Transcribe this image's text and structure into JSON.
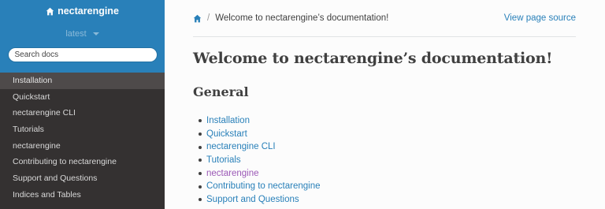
{
  "sidebar": {
    "project_name": "nectarengine",
    "version": "latest",
    "search_placeholder": "Search docs",
    "items": [
      {
        "label": "Installation"
      },
      {
        "label": "Quickstart"
      },
      {
        "label": "nectarengine CLI"
      },
      {
        "label": "Tutorials"
      },
      {
        "label": "nectarengine"
      },
      {
        "label": "Contributing to nectarengine"
      },
      {
        "label": "Support and Questions"
      },
      {
        "label": "Indices and Tables"
      }
    ]
  },
  "breadcrumb": {
    "current": "Welcome to nectarengine’s documentation!",
    "view_source": "View page source"
  },
  "main": {
    "title": "Welcome to nectarengine’s documentation!",
    "section_heading": "General",
    "toc": [
      {
        "label": "Installation"
      },
      {
        "label": "Quickstart"
      },
      {
        "label": "nectarengine CLI"
      },
      {
        "label": "Tutorials"
      },
      {
        "label": "nectarengine"
      },
      {
        "label": "Contributing to nectarengine"
      },
      {
        "label": "Support and Questions"
      }
    ]
  },
  "colors": {
    "accent": "#2980b9",
    "visited_link": "#9b59b6",
    "sidebar_bg": "#343131",
    "sidebar_current_bg": "#4e4a4a"
  },
  "icons": {
    "home": "home-icon",
    "version_caret": "caret-down-icon"
  }
}
